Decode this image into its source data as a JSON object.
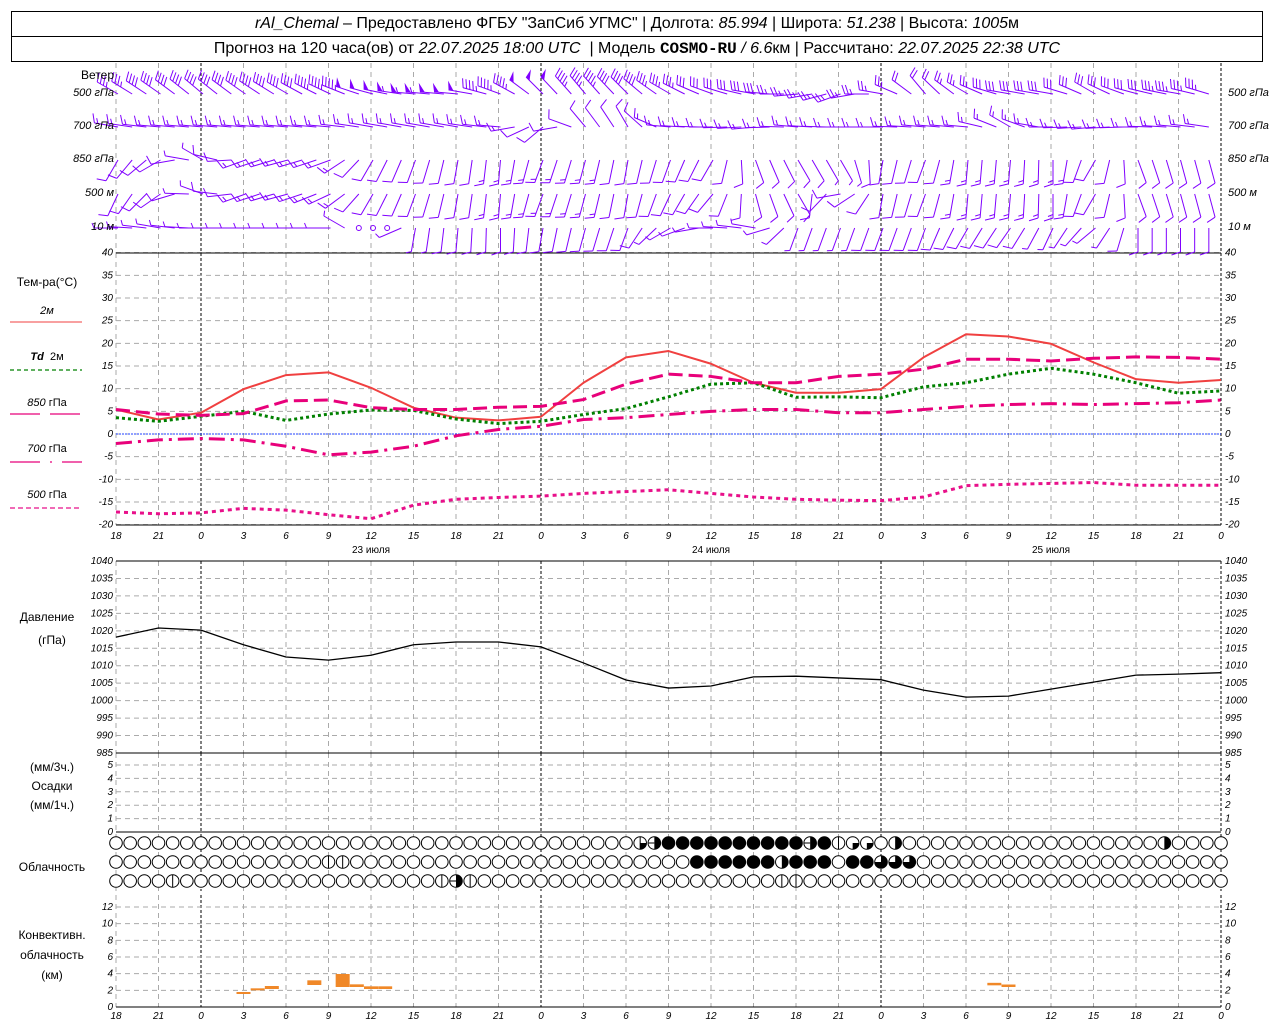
{
  "header": {
    "station": "rAl_Chemal",
    "provided_by": "– Предоставлено ФГБУ \"ЗапСиб УГМС\"",
    "lon_label": "Долгота:",
    "lon": "85.994",
    "lat_label": "Широта:",
    "lat": "51.238",
    "alt_label": "Высота:",
    "alt": "1005",
    "alt_unit": "м",
    "forecast_label": "Прогноз на 120 часа(ов) от",
    "forecast_start": "22.07.2025 18:00 UTC",
    "model_label": "Модель",
    "model": "COSMO-RU",
    "model_res": "/ 6.6",
    "model_res_unit": "км",
    "computed_label": "Рассчитано:",
    "computed": "22.07.2025 22:38 UTC"
  },
  "wind_panel": {
    "title": "Ветер",
    "levels": [
      "500 гПа",
      "700 гПа",
      "850 гПа",
      "500 м",
      "10 м"
    ],
    "color": "#8000ff",
    "series": [
      [
        [
          300,
          35
        ],
        [
          305,
          40
        ],
        [
          310,
          40
        ],
        [
          305,
          40
        ],
        [
          300,
          40
        ],
        [
          295,
          45
        ],
        [
          285,
          50
        ],
        [
          275,
          55
        ],
        [
          275,
          50
        ],
        [
          290,
          45
        ],
        [
          315,
          50
        ],
        [
          320,
          45
        ],
        [
          315,
          40
        ],
        [
          300,
          35
        ],
        [
          290,
          30
        ],
        [
          280,
          30
        ],
        [
          265,
          25
        ],
        [
          250,
          25
        ],
        [
          280,
          25
        ],
        [
          320,
          20
        ],
        [
          300,
          25
        ],
        [
          280,
          30
        ],
        [
          280,
          30
        ],
        [
          300,
          30
        ],
        [
          285,
          30
        ],
        [
          280,
          35
        ],
        [
          290,
          35
        ]
      ],
      [
        [
          280,
          15
        ],
        [
          275,
          15
        ],
        [
          275,
          15
        ],
        [
          275,
          15
        ],
        [
          275,
          15
        ],
        [
          275,
          15
        ],
        [
          280,
          15
        ],
        [
          280,
          15
        ],
        [
          280,
          15
        ],
        [
          275,
          15
        ],
        [
          230,
          10
        ],
        [
          320,
          10
        ],
        [
          330,
          10
        ],
        [
          275,
          15
        ],
        [
          270,
          15
        ],
        [
          265,
          15
        ],
        [
          275,
          15
        ],
        [
          270,
          15
        ],
        [
          270,
          15
        ],
        [
          275,
          15
        ],
        [
          275,
          15
        ],
        [
          300,
          15
        ],
        [
          270,
          15
        ],
        [
          265,
          15
        ],
        [
          270,
          15
        ],
        [
          275,
          15
        ],
        [
          280,
          15
        ]
      ],
      [
        [
          210,
          10
        ],
        [
          240,
          10
        ],
        [
          300,
          5
        ],
        [
          250,
          15
        ],
        [
          255,
          15
        ],
        [
          250,
          15
        ],
        [
          210,
          10
        ],
        [
          200,
          10
        ],
        [
          190,
          10
        ],
        [
          185,
          15
        ],
        [
          200,
          15
        ],
        [
          195,
          15
        ],
        [
          190,
          10
        ],
        [
          200,
          10
        ],
        [
          210,
          10
        ],
        [
          160,
          10
        ],
        [
          150,
          10
        ],
        [
          150,
          5
        ],
        [
          190,
          10
        ],
        [
          200,
          10
        ],
        [
          185,
          15
        ],
        [
          185,
          15
        ],
        [
          180,
          15
        ],
        [
          210,
          10
        ],
        [
          160,
          10
        ],
        [
          165,
          10
        ],
        [
          165,
          10
        ]
      ],
      [
        [
          205,
          10
        ],
        [
          235,
          10
        ],
        [
          290,
          5
        ],
        [
          250,
          15
        ],
        [
          255,
          15
        ],
        [
          245,
          15
        ],
        [
          210,
          10
        ],
        [
          200,
          10
        ],
        [
          190,
          10
        ],
        [
          185,
          15
        ],
        [
          200,
          15
        ],
        [
          195,
          15
        ],
        [
          190,
          10
        ],
        [
          205,
          10
        ],
        [
          220,
          10
        ],
        [
          165,
          10
        ],
        [
          150,
          10
        ],
        [
          260,
          10
        ],
        [
          190,
          10
        ],
        [
          200,
          10
        ],
        [
          185,
          15
        ],
        [
          185,
          15
        ],
        [
          180,
          15
        ],
        [
          210,
          10
        ],
        [
          160,
          10
        ],
        [
          165,
          10
        ],
        [
          165,
          10
        ]
      ],
      [
        [
          270,
          5
        ],
        [
          280,
          5
        ],
        [
          270,
          5
        ],
        [
          270,
          5
        ],
        [
          270,
          5
        ],
        [
          270,
          5
        ],
        [
          0,
          0
        ],
        [
          190,
          5
        ],
        [
          185,
          10
        ],
        [
          180,
          10
        ],
        [
          190,
          10
        ],
        [
          195,
          10
        ],
        [
          200,
          10
        ],
        [
          240,
          5
        ],
        [
          270,
          5
        ],
        [
          280,
          5
        ],
        [
          200,
          5
        ],
        [
          200,
          5
        ],
        [
          200,
          10
        ],
        [
          200,
          10
        ],
        [
          210,
          10
        ],
        [
          215,
          10
        ],
        [
          205,
          5
        ],
        [
          230,
          5
        ],
        [
          180,
          10
        ],
        [
          180,
          10
        ],
        [
          180,
          10
        ]
      ]
    ]
  },
  "temp_panel": {
    "title": "Тем-ра(°С)",
    "legend": [
      {
        "label": "2м",
        "color": "#f04040"
      },
      {
        "label_italic": "Td",
        "label": "2м",
        "color": "#008000"
      },
      {
        "label_italic": "850",
        "label": "гПа",
        "color": "#e8007a"
      },
      {
        "label_italic": "700",
        "label": "гПа",
        "color": "#e8007a"
      },
      {
        "label_italic": "500",
        "label": "гПа",
        "color": "#e8108a"
      }
    ],
    "zero_line_color": "#2040ff"
  },
  "pressure_panel": {
    "title": "Давление",
    "unit": "(гПа)"
  },
  "precip_panel": {
    "unit3": "(мм/3ч.)",
    "title": "Осадки",
    "unit1": "(мм/1ч.)"
  },
  "cloud_panel": {
    "title": "Облачность"
  },
  "conv_panel": {
    "title1": "Конвективн.",
    "title2": "облачность",
    "unit": "(км)",
    "color": "#f08828"
  },
  "x_axis": {
    "tick_labels": [
      "18",
      "21",
      "0",
      "3",
      "6",
      "9",
      "12",
      "15",
      "18",
      "21",
      "0",
      "3",
      "6",
      "9",
      "12",
      "15",
      "18",
      "21",
      "0",
      "3",
      "6",
      "9",
      "12",
      "15",
      "18",
      "21",
      "0"
    ],
    "dates": [
      "23 июля",
      "24 июля",
      "25 июля"
    ]
  },
  "chart_data": [
    {
      "type": "line",
      "title": "Тем-ра(°С)",
      "x_hours_from_start_step": 3,
      "ylim": [
        -20,
        40
      ],
      "yticks": [
        40,
        35,
        30,
        25,
        20,
        15,
        10,
        5,
        0,
        -5,
        -10,
        -15,
        -20
      ],
      "grid": true,
      "series": [
        {
          "name": "2м",
          "values": [
            5.4,
            3.2,
            4.7,
            9.9,
            13,
            13.6,
            10.2,
            5.8,
            3.6,
            3.0,
            3.8,
            11.3,
            16.9,
            18.3,
            15.5,
            11.3,
            9.1,
            9.1,
            9.9,
            16.9,
            22,
            21.5,
            19.9,
            15.8,
            12.1,
            11.3,
            11.9
          ]
        },
        {
          "name": "Td 2м",
          "values": [
            3.6,
            2.8,
            3.9,
            5.0,
            3.0,
            4.4,
            5.3,
            5.2,
            3.3,
            2.3,
            2.8,
            4.3,
            5.6,
            8.2,
            11,
            11.3,
            8.1,
            8.2,
            8,
            10.4,
            11.3,
            13.2,
            14.5,
            13.2,
            11.3,
            9,
            9.5
          ]
        },
        {
          "name": "850 гПа",
          "values": [
            5.4,
            4.4,
            4.1,
            4.5,
            7.3,
            7.5,
            5.8,
            5.4,
            5.4,
            5.9,
            6.1,
            7.6,
            11,
            13.2,
            12.7,
            11.3,
            11.3,
            12.7,
            13.2,
            14.3,
            16.5,
            16.5,
            16.1,
            16.7,
            17,
            16.9,
            16.5
          ]
        },
        {
          "name": "700 гПа",
          "values": [
            -2.1,
            -1.3,
            -1,
            -1.3,
            -2.7,
            -4.6,
            -4,
            -2.7,
            -0.4,
            1,
            1.7,
            3.2,
            3.6,
            4.3,
            5,
            5.4,
            5.4,
            4.7,
            4.7,
            5.4,
            6.1,
            6.5,
            6.7,
            6.5,
            6.7,
            6.9,
            7.5
          ]
        },
        {
          "name": "500 гПа",
          "values": [
            -17.2,
            -17.6,
            -17.4,
            -16.4,
            -16.8,
            -17.8,
            -18.7,
            -15.7,
            -14.4,
            -14,
            -13.7,
            -13.1,
            -12.7,
            -12.3,
            -13.1,
            -13.9,
            -14.4,
            -14.6,
            -14.7,
            -13.9,
            -11.4,
            -11.1,
            -10.9,
            -10.7,
            -11.3,
            -11.3,
            -11.3
          ]
        }
      ]
    },
    {
      "type": "line",
      "title": "Давление (гПа)",
      "x_hours_from_start_step": 3,
      "ylim": [
        985,
        1040
      ],
      "yticks": [
        1040,
        1035,
        1030,
        1025,
        1020,
        1015,
        1010,
        1005,
        1000,
        995,
        990,
        985
      ],
      "grid": true,
      "series": [
        {
          "values": [
            1018.2,
            1020.8,
            1020.2,
            1016,
            1012.5,
            1011.6,
            1013,
            1016,
            1016.8,
            1016.8,
            1015.4,
            1010.8,
            1005.9,
            1003.6,
            1004.2,
            1006.8,
            1007,
            1006.5,
            1006,
            1003,
            1001,
            1001.3,
            1003.3,
            1005.3,
            1007.3,
            1007.6,
            1008
          ]
        }
      ]
    },
    {
      "type": "bar",
      "title": "Осадки",
      "ylim": [
        0,
        5
      ],
      "yticks": [
        5,
        4,
        3,
        2,
        1,
        0
      ],
      "values": []
    },
    {
      "type": "table",
      "title": "Облачность",
      "rows_hourly_codes": [
        {
          "37": 3,
          "38": 5,
          "39": 8,
          "40": 8,
          "41": 8,
          "42": 8,
          "43": 8,
          "44": 8,
          "45": 8,
          "46": 8,
          "47": 8,
          "48": 8,
          "49": 5,
          "50": 8,
          "51": 1,
          "52": 2,
          "53": 2,
          "55": 4,
          "74": 4
        },
        {
          "15": 1,
          "16": 1,
          "41": 8,
          "42": 8,
          "43": 8,
          "44": 8,
          "45": 8,
          "46": 8,
          "47": 4,
          "48": 8,
          "49": 8,
          "50": 8,
          "52": 8,
          "53": 8,
          "54": 6,
          "55": 6,
          "56": 6
        },
        {
          "4": 1,
          "23": 1,
          "24": 5,
          "25": 1,
          "47": 1,
          "48": 1
        }
      ]
    },
    {
      "type": "bar",
      "title": "Конвективн. облачность (км)",
      "ylim": [
        0,
        12
      ],
      "yticks": [
        12,
        10,
        8,
        6,
        4,
        2,
        0
      ],
      "bars_hour_base_top": [
        [
          9,
          1.56,
          1.8
        ],
        [
          10,
          2.0,
          2.24
        ],
        [
          11,
          2.16,
          2.52
        ],
        [
          14,
          2.64,
          3.2
        ],
        [
          16,
          2.4,
          3.96
        ],
        [
          17,
          2.4,
          2.72
        ],
        [
          18,
          2.16,
          2.48
        ],
        [
          19,
          2.16,
          2.48
        ],
        [
          62,
          2.6,
          2.9
        ],
        [
          63,
          2.4,
          2.7
        ]
      ]
    }
  ]
}
